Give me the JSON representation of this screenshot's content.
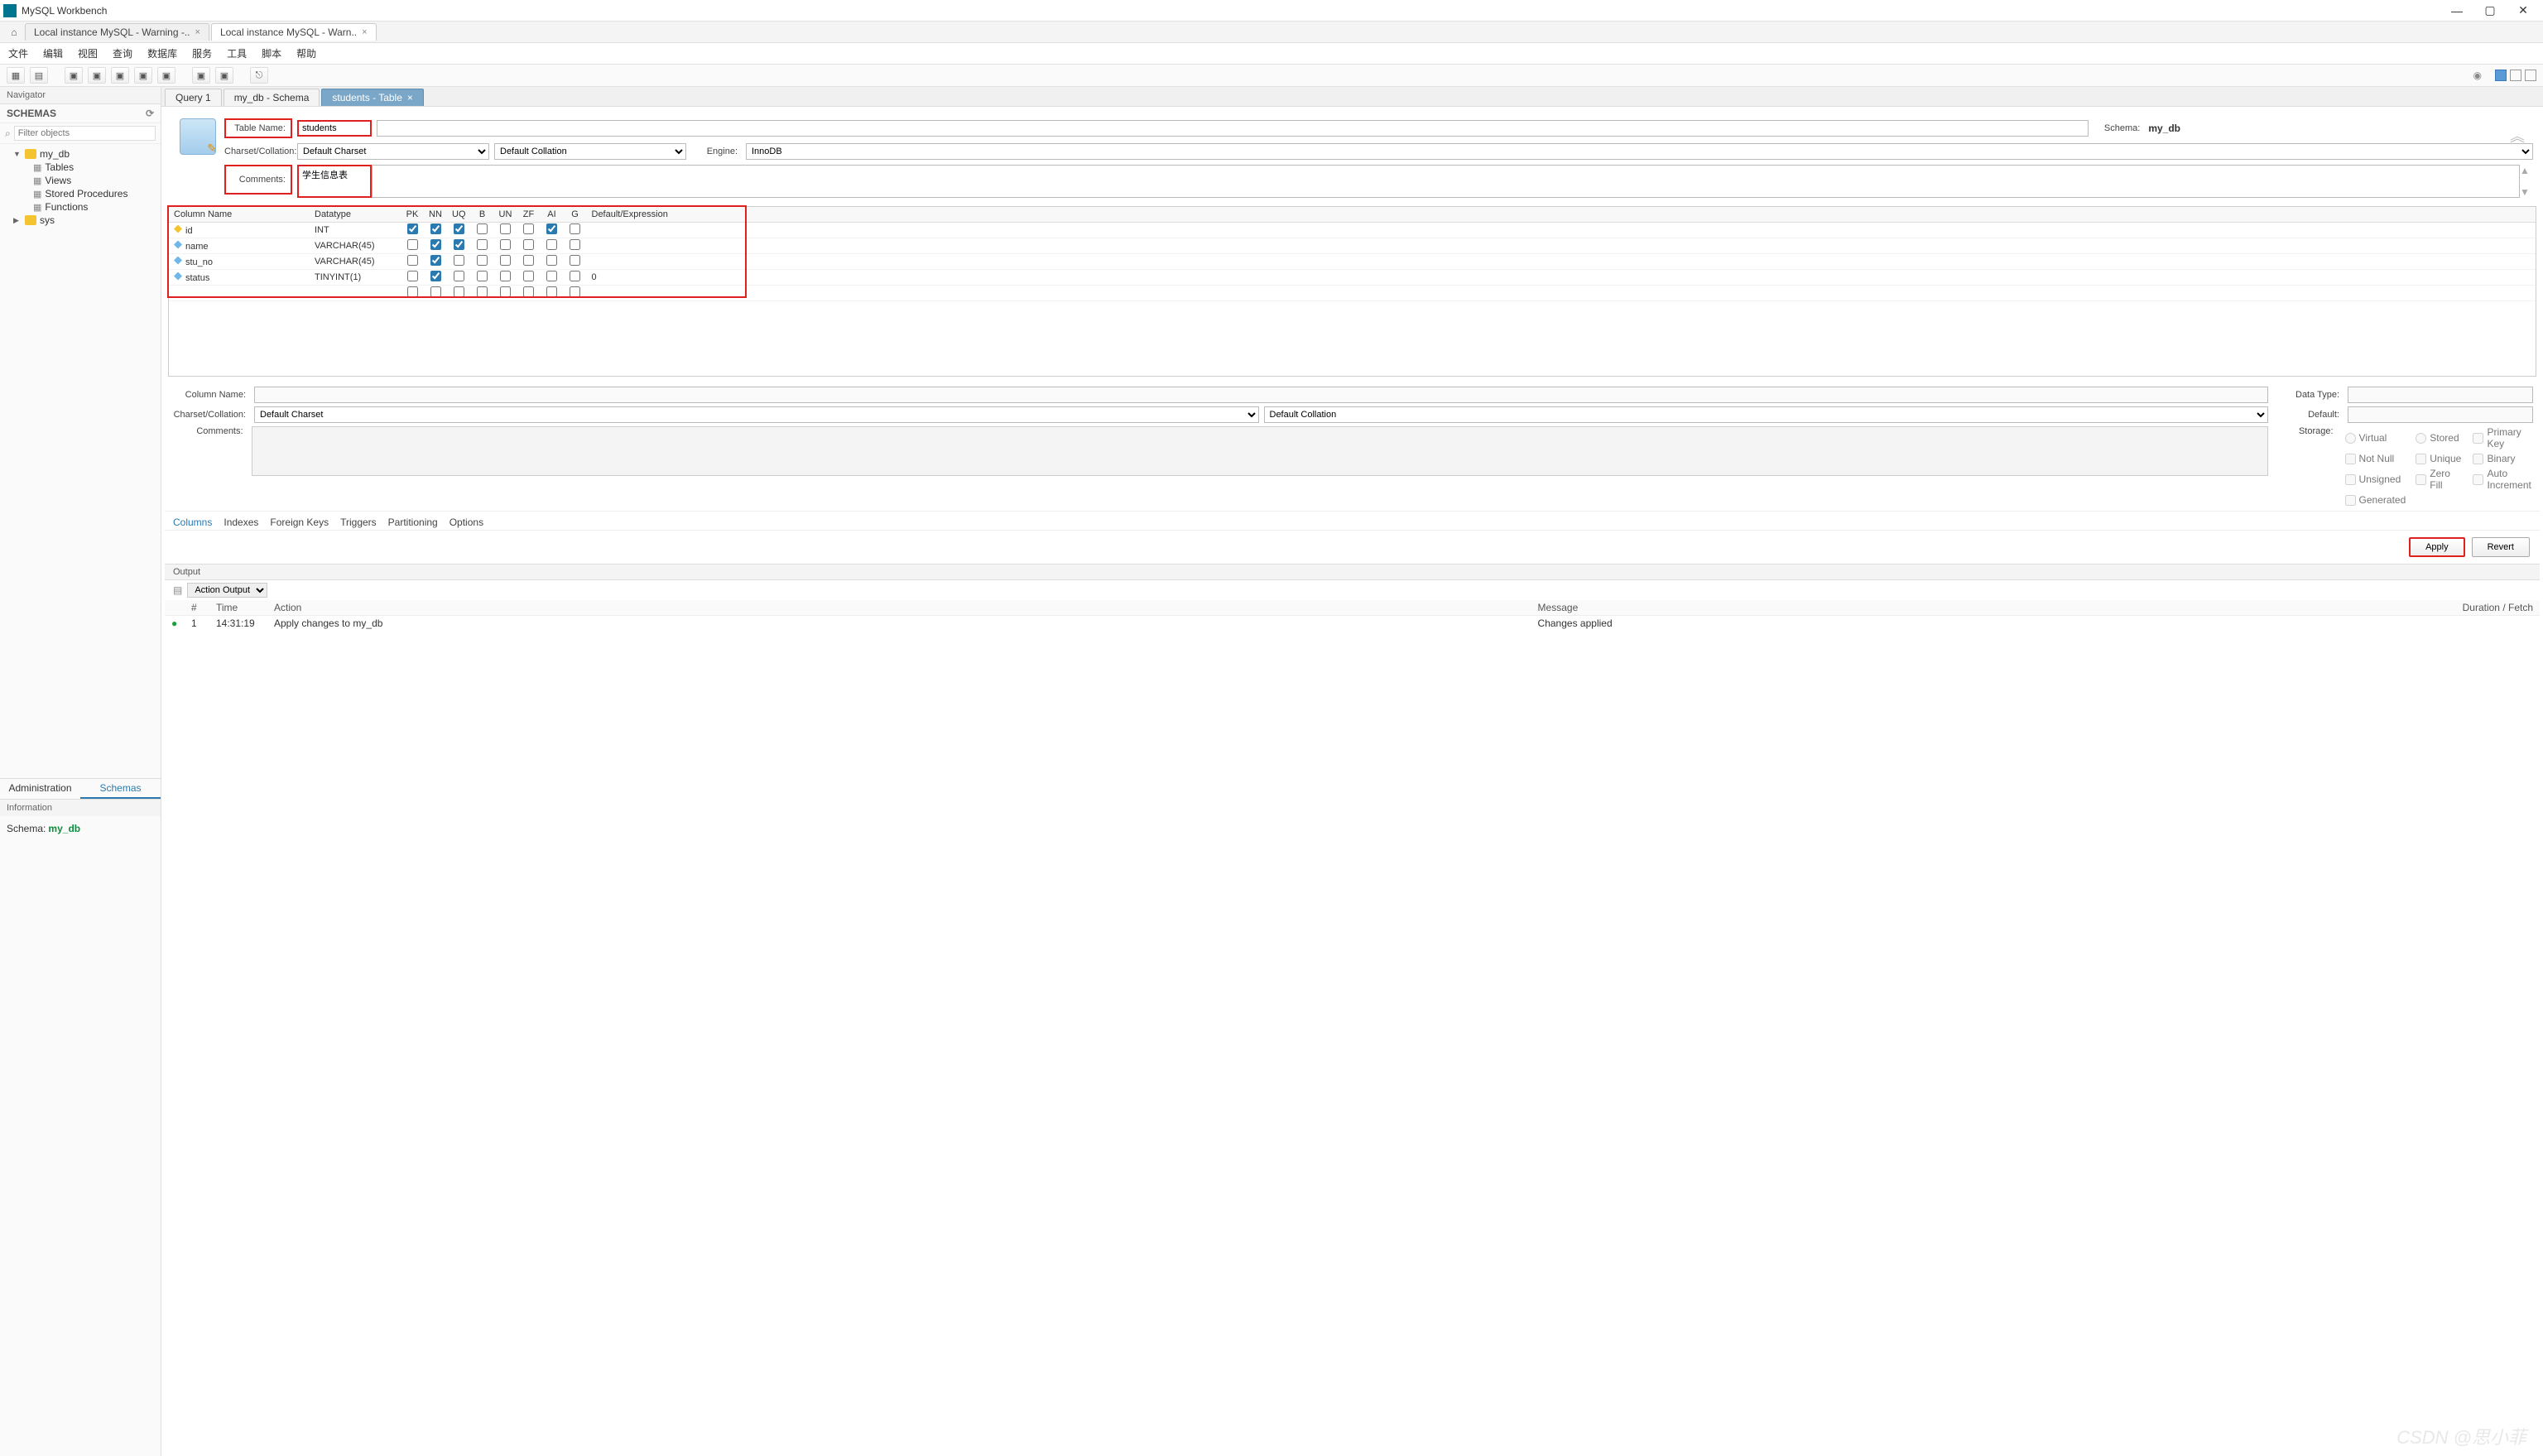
{
  "app": {
    "title": "MySQL Workbench"
  },
  "window_controls": {
    "min": "—",
    "max": "▢",
    "close": "✕"
  },
  "conn_tabs": [
    {
      "label": "Local instance MySQL - Warning -..",
      "active": false
    },
    {
      "label": "Local instance MySQL - Warn..",
      "active": true
    }
  ],
  "menu": [
    "文件",
    "编辑",
    "视图",
    "查询",
    "数据库",
    "服务",
    "工具",
    "脚本",
    "帮助"
  ],
  "navigator": {
    "title": "Navigator",
    "section": "SCHEMAS",
    "filter_placeholder": "Filter objects",
    "tree": {
      "db": "my_db",
      "children": [
        "Tables",
        "Views",
        "Stored Procedures",
        "Functions"
      ],
      "other": "sys"
    },
    "tabs": {
      "admin": "Administration",
      "schemas": "Schemas"
    },
    "info_title": "Information",
    "info_label": "Schema:",
    "info_value": "my_db"
  },
  "doc_tabs": [
    {
      "label": "Query 1",
      "active": false
    },
    {
      "label": "my_db - Schema",
      "active": false
    },
    {
      "label": "students - Table",
      "active": true,
      "closable": true
    }
  ],
  "form": {
    "table_name_label": "Table Name:",
    "table_name": "students",
    "schema_label": "Schema:",
    "schema": "my_db",
    "charset_label": "Charset/Collation:",
    "charset": "Default Charset",
    "collation": "Default Collation",
    "engine_label": "Engine:",
    "engine": "InnoDB",
    "comments_label": "Comments:",
    "comments": "学生信息表"
  },
  "columns_grid": {
    "headers": [
      "Column Name",
      "Datatype",
      "PK",
      "NN",
      "UQ",
      "B",
      "UN",
      "ZF",
      "AI",
      "G",
      "Default/Expression"
    ],
    "rows": [
      {
        "icon": "key",
        "name": "id",
        "type": "INT",
        "pk": true,
        "nn": true,
        "uq": true,
        "b": false,
        "un": false,
        "zf": false,
        "ai": true,
        "g": false,
        "def": ""
      },
      {
        "icon": "col",
        "name": "name",
        "type": "VARCHAR(45)",
        "pk": false,
        "nn": true,
        "uq": true,
        "b": false,
        "un": false,
        "zf": false,
        "ai": false,
        "g": false,
        "def": ""
      },
      {
        "icon": "col",
        "name": "stu_no",
        "type": "VARCHAR(45)",
        "pk": false,
        "nn": true,
        "uq": false,
        "b": false,
        "un": false,
        "zf": false,
        "ai": false,
        "g": false,
        "def": ""
      },
      {
        "icon": "col",
        "name": "status",
        "type": "TINYINT(1)",
        "pk": false,
        "nn": true,
        "uq": false,
        "b": false,
        "un": false,
        "zf": false,
        "ai": false,
        "g": false,
        "def": "0"
      }
    ]
  },
  "col_detail": {
    "name_label": "Column Name:",
    "datatype_label": "Data Type:",
    "charset_label": "Charset/Collation:",
    "charset": "Default Charset",
    "collation": "Default Collation",
    "default_label": "Default:",
    "comments_label": "Comments:",
    "storage_label": "Storage:",
    "opts": [
      "Virtual",
      "Stored",
      "Primary Key",
      "Not Null",
      "Unique",
      "Binary",
      "Unsigned",
      "Zero Fill",
      "Auto Increment",
      "Generated"
    ]
  },
  "subtabs": [
    "Columns",
    "Indexes",
    "Foreign Keys",
    "Triggers",
    "Partitioning",
    "Options"
  ],
  "buttons": {
    "apply": "Apply",
    "revert": "Revert"
  },
  "output": {
    "title": "Output",
    "selector": "Action Output",
    "headers": [
      "",
      "#",
      "Time",
      "Action",
      "Message",
      "Duration / Fetch"
    ],
    "row": {
      "num": "1",
      "time": "14:31:19",
      "action": "Apply changes to my_db",
      "message": "Changes applied",
      "duration": ""
    }
  },
  "watermark": "CSDN @思小菲"
}
